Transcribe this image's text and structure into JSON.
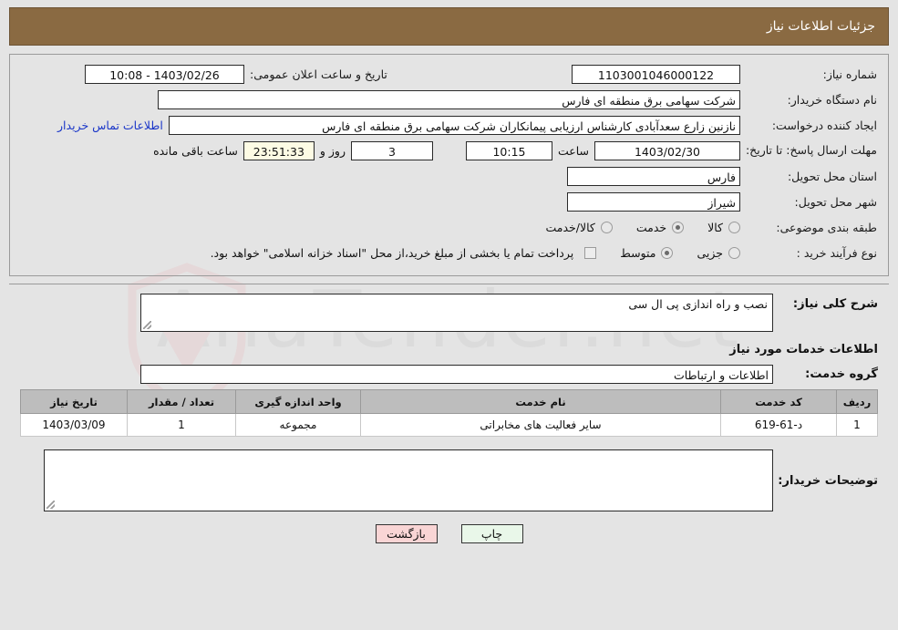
{
  "header": {
    "title": "جزئیات اطلاعات نیاز",
    "bar_color": "#8a6a42"
  },
  "details": {
    "need_number_label": "شماره نیاز:",
    "need_number_value": "1103001046000122",
    "announce_label": "تاریخ و ساعت اعلان عمومی:",
    "announce_value": "1403/02/26 - 10:08",
    "buyer_org_label": "نام دستگاه خریدار:",
    "buyer_org_value": "شرکت سهامی برق منطقه ای فارس",
    "creator_label": "ایجاد کننده درخواست:",
    "creator_value": "نازنین زارع سعدآبادی کارشناس ارزیابی پیمانکاران شرکت سهامی برق منطقه ای فارس",
    "contact_link": "اطلاعات تماس خریدار",
    "deadline_label": "مهلت ارسال پاسخ: تا تاریخ:",
    "deadline_date": "1403/02/30",
    "deadline_hour_label": "ساعت",
    "deadline_hour": "10:15",
    "remaining_days": "3",
    "remaining_days_label": "روز و",
    "remaining_time": "23:51:33",
    "remaining_time_label": "ساعت باقی مانده",
    "province_label": "استان محل تحویل:",
    "province_value": "فارس",
    "city_label": "شهر محل تحویل:",
    "city_value": "شیراز",
    "category_label": "طبقه بندی موضوعی:",
    "category_options": [
      {
        "label": "کالا",
        "selected": false
      },
      {
        "label": "خدمت",
        "selected": true
      },
      {
        "label": "کالا/خدمت",
        "selected": false
      }
    ],
    "process_label": "نوع فرآیند خرید :",
    "process_options": [
      {
        "label": "جزیی",
        "selected": false
      },
      {
        "label": "متوسط",
        "selected": true
      }
    ],
    "treasury_checkbox_text": "پرداخت تمام یا بخشی از مبلغ خرید،از محل \"اسناد خزانه اسلامی\" خواهد بود.",
    "treasury_checked": false
  },
  "description": {
    "label": "شرح کلی نیاز:",
    "value": "نصب و راه اندازی پی ال سی"
  },
  "services": {
    "section_title": "اطلاعات خدمات مورد نیاز",
    "group_label": "گروه خدمت:",
    "group_value": "اطلاعات و ارتباطات",
    "columns": [
      "ردیف",
      "کد خدمت",
      "نام خدمت",
      "واحد اندازه گیری",
      "تعداد / مقدار",
      "تاریخ نیاز"
    ],
    "rows": [
      {
        "index": "1",
        "code": "د-61-619",
        "name": "سایر فعالیت های مخابراتی",
        "unit": "مجموعه",
        "quantity": "1",
        "need_date": "1403/03/09"
      }
    ]
  },
  "buyer_comments": {
    "label": "توضیحات خریدار:",
    "value": ""
  },
  "footer": {
    "print_label": "چاپ",
    "back_label": "بازگشت"
  },
  "watermark": {
    "text": "AnaTender.net"
  }
}
